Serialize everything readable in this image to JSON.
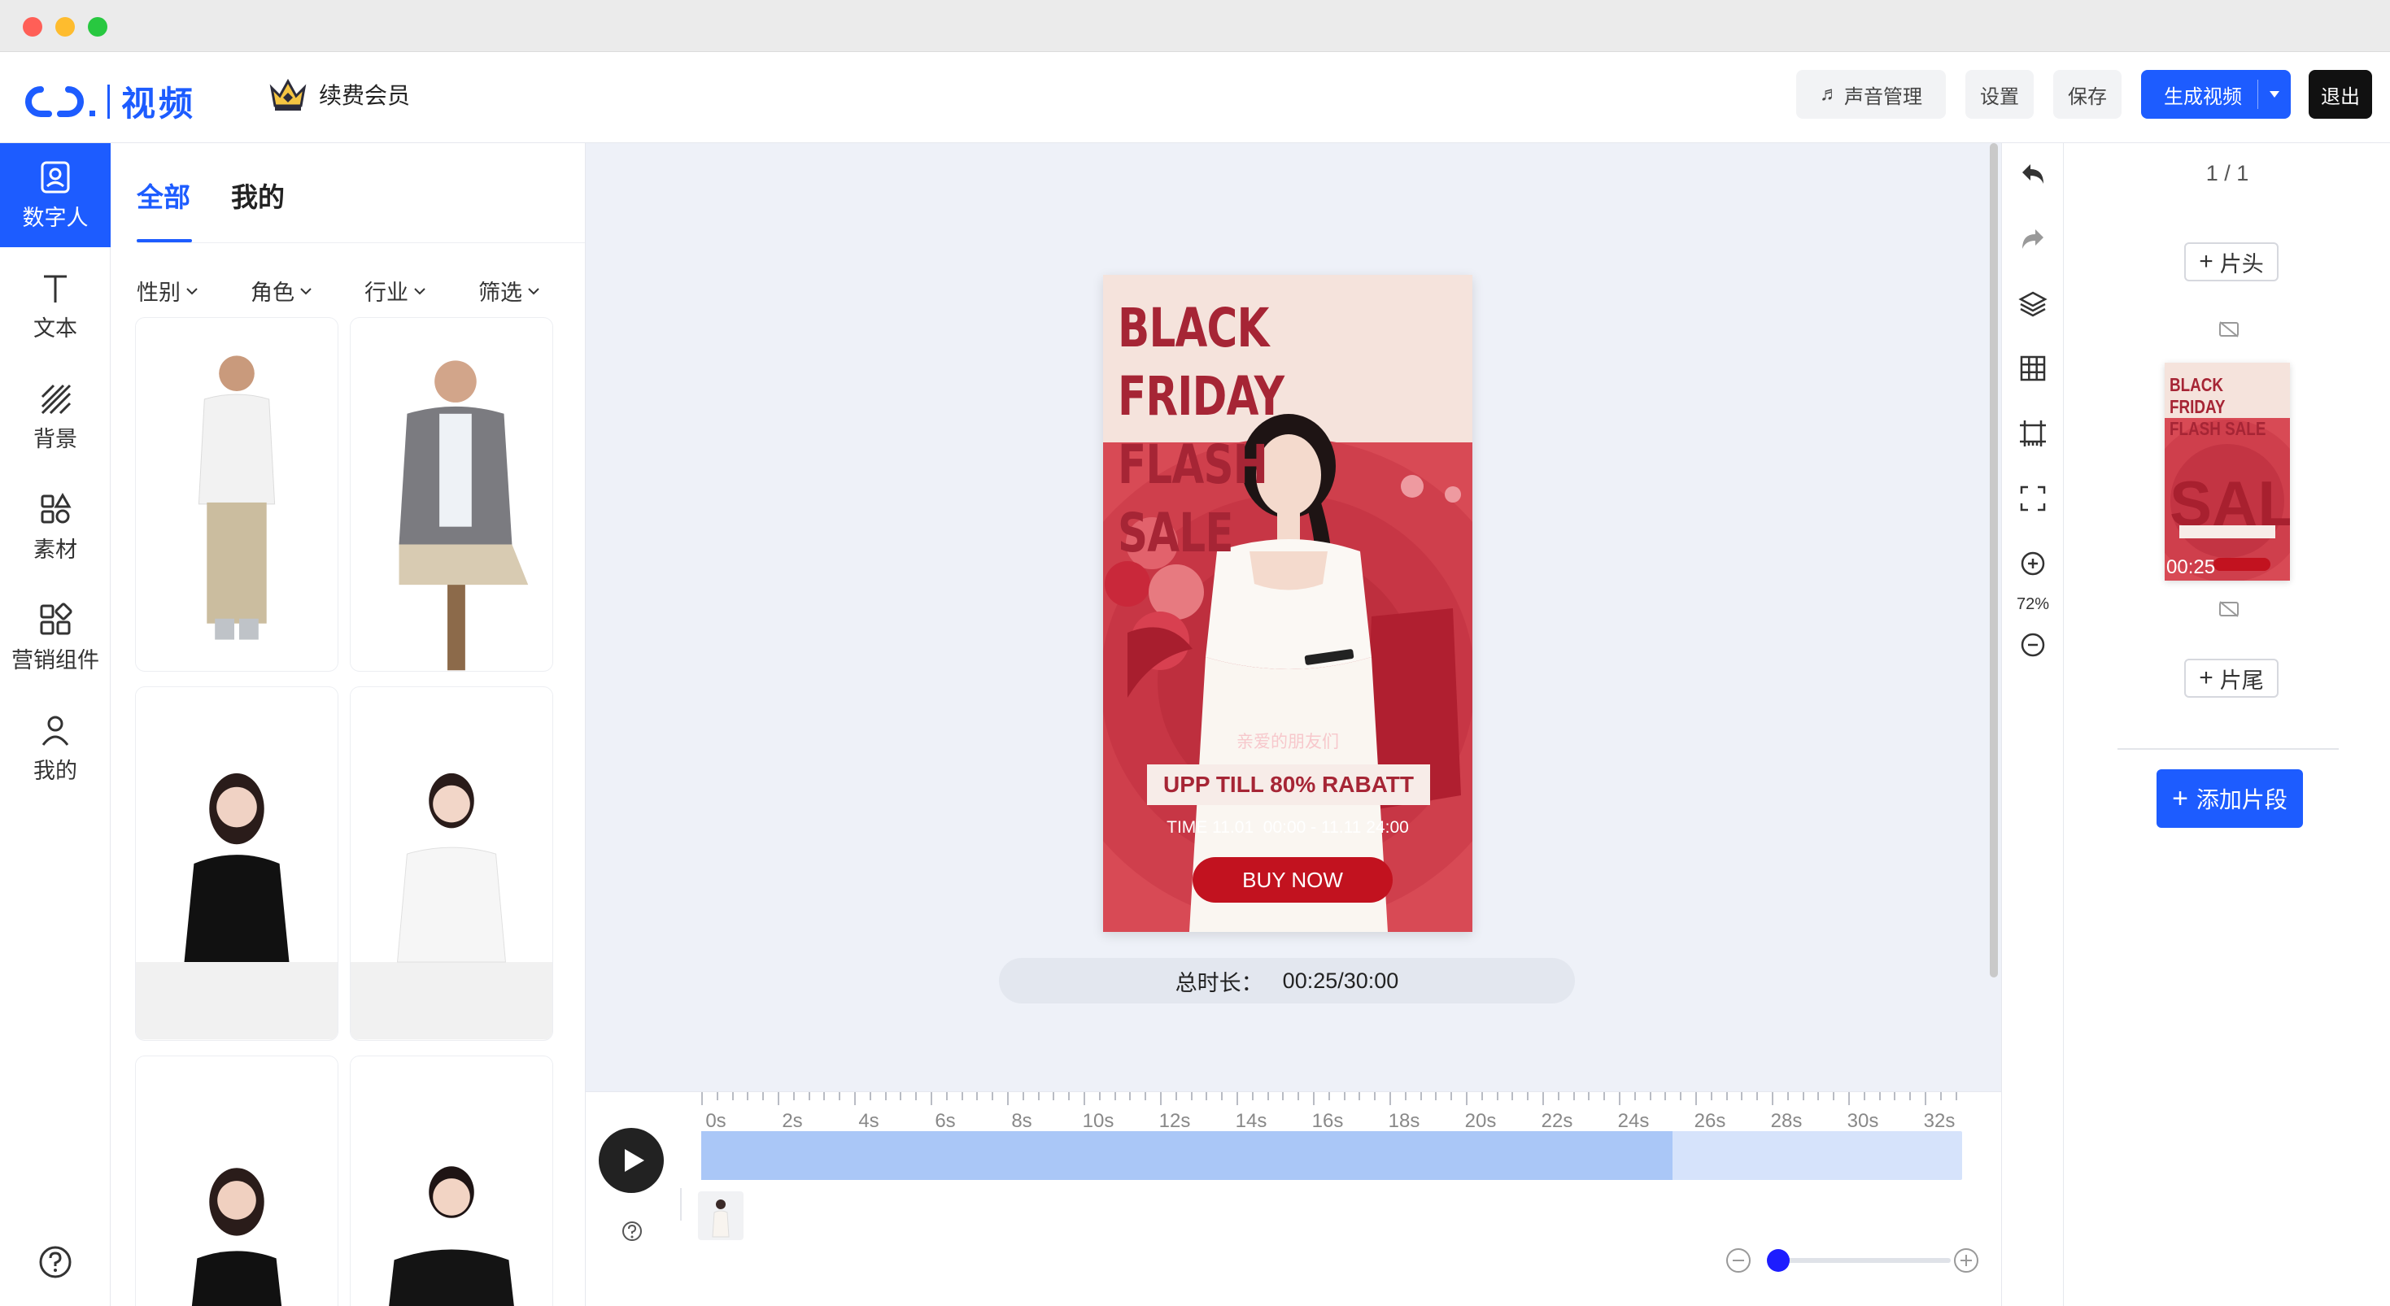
{
  "window": {
    "traffic_colors": [
      "#ff5f57",
      "#febc2e",
      "#28c840"
    ]
  },
  "header": {
    "logo_text": "视频",
    "vip_label": "续费会员",
    "sound_label": "声音管理",
    "settings_label": "设置",
    "save_label": "保存",
    "generate_label": "生成视频",
    "exit_label": "退出"
  },
  "nav": {
    "items": [
      {
        "label": "数字人",
        "icon": "digital-human-icon",
        "active": true
      },
      {
        "label": "文本",
        "icon": "text-icon"
      },
      {
        "label": "背景",
        "icon": "background-icon"
      },
      {
        "label": "素材",
        "icon": "material-icon"
      },
      {
        "label": "营销组件",
        "icon": "marketing-icon"
      },
      {
        "label": "我的",
        "icon": "user-icon"
      }
    ],
    "help_icon": "help-icon"
  },
  "panel": {
    "tabs": [
      "全部",
      "我的"
    ],
    "active_tab": "全部",
    "filters": [
      "性别",
      "角色",
      "行业",
      "筛选"
    ]
  },
  "poster": {
    "title_line1": "BLACK FRIDAY",
    "title_line2": "FLASH SALE",
    "greeting": "亲爱的朋友们",
    "banner": "UPP TILL 80% RABATT",
    "time": "TIME 11.01  00:00 - 11.11 24:00",
    "cta": "BUY NOW"
  },
  "duration": {
    "label": "总时长：",
    "value": "00:25/30:00"
  },
  "toolbar": {
    "zoom": "72%"
  },
  "clips": {
    "pager": "1 / 1",
    "head_label": "片头",
    "tail_label": "片尾",
    "thumb_title1": "BLACK FRIDAY",
    "thumb_title2": "FLASH SALE",
    "thumb_duration": "00:25",
    "add_segment_label": "添加片段"
  },
  "timeline": {
    "ticks": [
      "0s",
      "2s",
      "4s",
      "6s",
      "8s",
      "10s",
      "12s",
      "14s",
      "16s",
      "18s",
      "20s",
      "22s",
      "24s",
      "26s",
      "28s",
      "30s",
      "32s"
    ],
    "progress_fraction": 0.77,
    "zoom_slider_fraction": 0.0
  },
  "colors": {
    "accent": "#1d5cff",
    "poster_red": "#a62535",
    "poster_bg": "#d84a55"
  }
}
